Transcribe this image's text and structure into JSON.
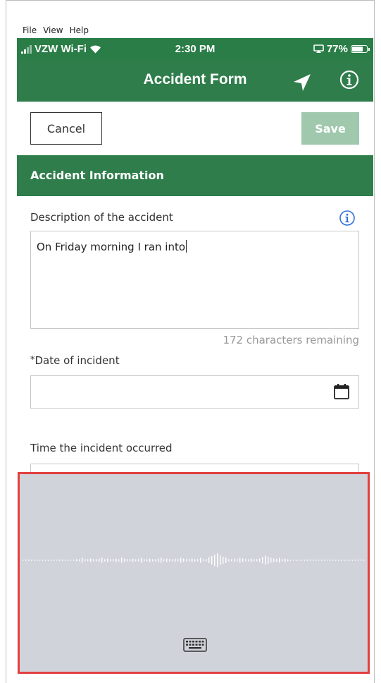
{
  "menu": [
    "File",
    "View",
    "Help"
  ],
  "status": {
    "carrier": "VZW Wi-Fi",
    "time": "2:30 PM",
    "battery": "77%"
  },
  "nav": {
    "title": "Accident Form",
    "location_icon": "location-arrow-icon",
    "info_icon": "info-circle-icon"
  },
  "actions": {
    "cancel": "Cancel",
    "save": "Save"
  },
  "section": {
    "title": "Accident Information"
  },
  "description": {
    "label": "Description of the accident",
    "value": "On Friday morning I ran into",
    "remaining": "172 characters remaining"
  },
  "date": {
    "required_marker": "*",
    "label": "Date of incident",
    "value": ""
  },
  "time": {
    "label": "Time the incident occurred",
    "value": ""
  },
  "dictation": {
    "keyboard_icon": "keyboard-icon"
  },
  "colors": {
    "brand_green": "#2e7d4b",
    "save_disabled": "#9fc8ad",
    "dictation_bg": "#d1d3db",
    "highlight_border": "#e2403f"
  }
}
